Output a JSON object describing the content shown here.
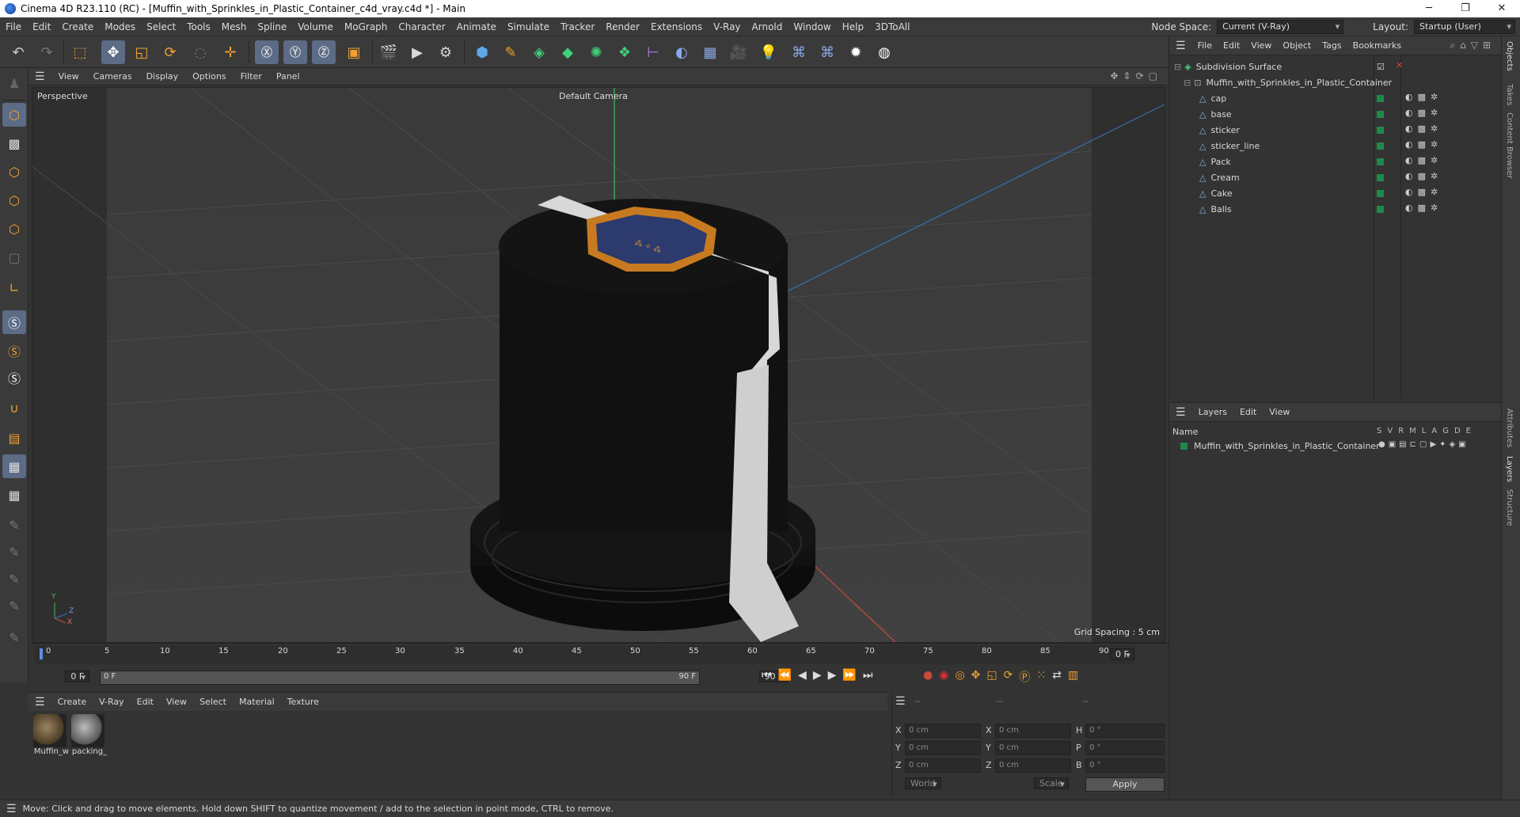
{
  "window": {
    "title": "Cinema 4D R23.110 (RC) - [Muffin_with_Sprinkles_in_Plastic_Container_c4d_vray.c4d *] - Main",
    "minimize": "─",
    "maximize": "❐",
    "close": "✕"
  },
  "menubar": {
    "items": [
      "File",
      "Edit",
      "Create",
      "Modes",
      "Select",
      "Tools",
      "Mesh",
      "Spline",
      "Volume",
      "MoGraph",
      "Character",
      "Animate",
      "Simulate",
      "Tracker",
      "Render",
      "Extensions",
      "V-Ray",
      "Arnold",
      "Window",
      "Help",
      "3DToAll"
    ],
    "node_space_label": "Node Space:",
    "node_space_value": "Current (V-Ray)",
    "layout_label": "Layout:",
    "layout_value": "Startup (User)"
  },
  "viewport": {
    "menu": [
      "View",
      "Cameras",
      "Display",
      "Options",
      "Filter",
      "Panel"
    ],
    "label": "Perspective",
    "camera": "Default Camera",
    "grid_spacing": "Grid Spacing : 5 cm",
    "axis_y": "Y",
    "axis_z": "Z",
    "axis_x": "X"
  },
  "timeline": {
    "ticks": [
      "0",
      "5",
      "10",
      "15",
      "20",
      "25",
      "30",
      "35",
      "40",
      "45",
      "50",
      "55",
      "60",
      "65",
      "70",
      "75",
      "80",
      "85",
      "90"
    ],
    "current_frame_display": "0 F",
    "start_field": "0 F",
    "range_start": "0 F",
    "range_end": "90 F",
    "end_field": "90 F"
  },
  "materials": {
    "menu": [
      "Create",
      "V-Ray",
      "Edit",
      "View",
      "Select",
      "Material",
      "Texture"
    ],
    "items": [
      {
        "label": "Muffin_w"
      },
      {
        "label": "packing_"
      }
    ]
  },
  "coords": {
    "headers": [
      "--",
      "--",
      "--"
    ],
    "x_pos": "0 cm",
    "y_pos": "0 cm",
    "z_pos": "0 cm",
    "x_size": "0 cm",
    "y_size": "0 cm",
    "z_size": "0 cm",
    "h": "0 °",
    "p": "0 °",
    "b": "0 °",
    "labels": {
      "x": "X",
      "y": "Y",
      "z": "Z",
      "h": "H",
      "p": "P",
      "b": "B"
    },
    "world": "World",
    "scale": "Scale",
    "apply": "Apply"
  },
  "objects": {
    "menu": [
      "File",
      "Edit",
      "View",
      "Object",
      "Tags",
      "Bookmarks"
    ],
    "root": "Subdivision Surface",
    "container": "Muffin_with_Sprinkles_in_Plastic_Container",
    "children": [
      "cap",
      "base",
      "sticker",
      "sticker_line",
      "Pack",
      "Cream",
      "Cake",
      "Balls"
    ]
  },
  "layers": {
    "menu": [
      "Layers",
      "Edit",
      "View"
    ],
    "name_header": "Name",
    "col_headers": [
      "S",
      "V",
      "R",
      "M",
      "L",
      "A",
      "G",
      "D",
      "E"
    ],
    "row": "Muffin_with_Sprinkles_in_Plastic_Container"
  },
  "sidetabs": [
    "Objects",
    "Takes",
    "Content Browser",
    "Attributes",
    "Layers",
    "Structure"
  ],
  "status": "Move: Click and drag to move elements. Hold down SHIFT to quantize movement / add to the selection in point mode, CTRL to remove."
}
